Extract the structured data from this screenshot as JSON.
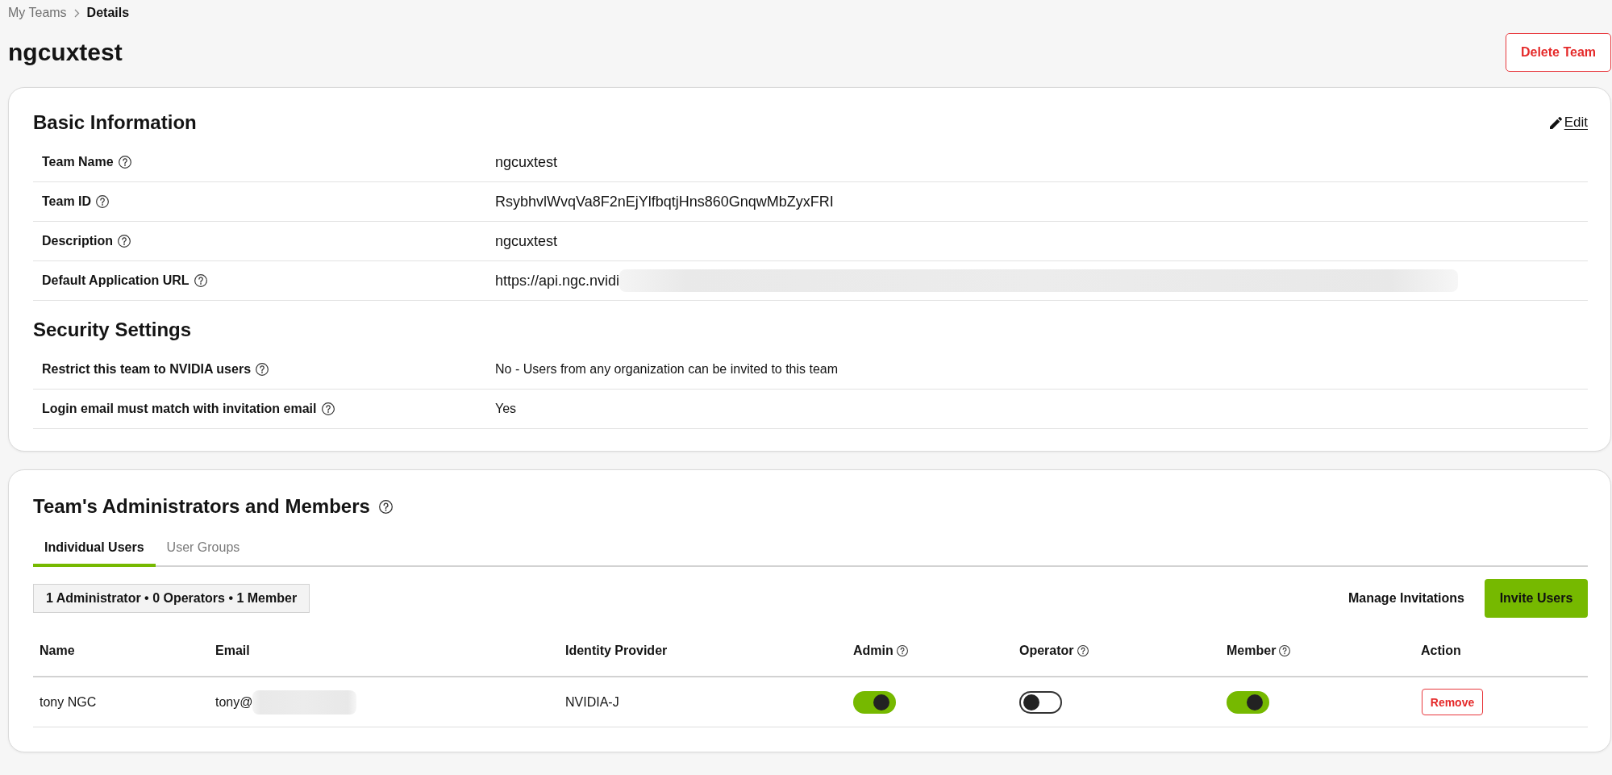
{
  "breadcrumb": [
    {
      "label": "My Teams",
      "current": false
    },
    {
      "label": "Details",
      "current": true
    }
  ],
  "page_title": "ngcuxtest",
  "delete_button": "Delete Team",
  "basic_information": {
    "heading": "Basic Information",
    "edit_link": "Edit",
    "rows": [
      {
        "label": "Team Name",
        "help": true,
        "value": "ngcuxtest",
        "redacted": false
      },
      {
        "label": "Team ID",
        "help": true,
        "value": "RsybhvlWvqVa8F2nEjYlfbqtjHns860GnqwMbZyxFRI",
        "redacted": false
      },
      {
        "label": "Description",
        "help": true,
        "value": "ngcuxtest",
        "redacted": false
      },
      {
        "label": "Default Application URL",
        "help": true,
        "value": "https://api.ngc.nvidi",
        "redacted": true
      }
    ]
  },
  "security_settings": {
    "heading": "Security Settings",
    "rows": [
      {
        "label": "Restrict this team to NVIDIA users",
        "help": true,
        "value": "No - Users from any organization can be invited to this team"
      },
      {
        "label": "Login email must match with invitation email",
        "help": true,
        "value": "Yes"
      }
    ]
  },
  "members": {
    "heading": "Team's Administrators and Members",
    "heading_help": true,
    "tabs": [
      {
        "label": "Individual Users",
        "selected": true
      },
      {
        "label": "User Groups",
        "selected": false
      }
    ],
    "summary": "1 Administrator • 0 Operators • 1 Member",
    "manage_invitations": "Manage Invitations",
    "invite_button": "Invite Users",
    "columns": [
      {
        "label": "Name",
        "help": false
      },
      {
        "label": "Email",
        "help": false
      },
      {
        "label": "Identity Provider",
        "help": false
      },
      {
        "label": "Admin",
        "help": true
      },
      {
        "label": "Operator",
        "help": true
      },
      {
        "label": "Member",
        "help": true
      },
      {
        "label": "Action",
        "help": false
      }
    ],
    "rows": [
      {
        "name": "tony NGC",
        "email": "tony@",
        "email_redacted": true,
        "identity_provider": "NVIDIA-J",
        "admin": true,
        "operator": false,
        "member": true,
        "action": "Remove"
      }
    ]
  }
}
